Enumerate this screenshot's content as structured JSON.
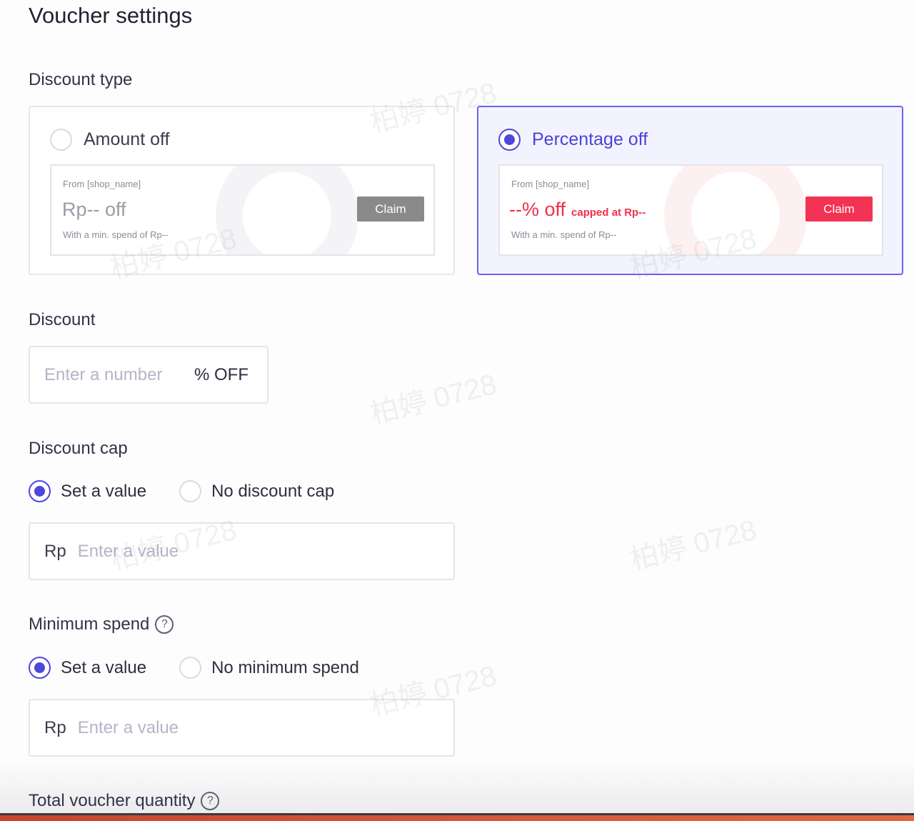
{
  "title": "Voucher settings",
  "discount_type": {
    "label": "Discount type",
    "options": [
      {
        "label": "Amount off",
        "selected": false,
        "preview": {
          "from": "From [shop_name]",
          "value": "Rp-- off",
          "min_spend": "With a min. spend of Rp--",
          "claim": "Claim",
          "claim_color": "#8a8a8a"
        }
      },
      {
        "label": "Percentage off",
        "selected": true,
        "preview": {
          "from": "From [shop_name]",
          "value": "--% off",
          "cap": "capped at Rp--",
          "min_spend": "With a min. spend of Rp--",
          "claim": "Claim",
          "claim_color": "#f23354"
        }
      }
    ]
  },
  "discount": {
    "label": "Discount",
    "placeholder": "Enter a number",
    "suffix": "% OFF"
  },
  "discount_cap": {
    "label": "Discount cap",
    "options": [
      {
        "label": "Set a value",
        "selected": true
      },
      {
        "label": "No discount cap",
        "selected": false
      }
    ],
    "prefix": "Rp",
    "placeholder": "Enter a value"
  },
  "minimum_spend": {
    "label": "Minimum spend",
    "help_icon": "question-circle-icon",
    "options": [
      {
        "label": "Set a value",
        "selected": true
      },
      {
        "label": "No minimum spend",
        "selected": false
      }
    ],
    "prefix": "Rp",
    "placeholder": "Enter a value"
  },
  "total_quantity": {
    "label": "Total voucher quantity",
    "help_icon": "question-circle-icon"
  },
  "watermark": "柏婷 0728",
  "colors": {
    "accent": "#4f47d9",
    "danger": "#f23354",
    "border": "#e4e5ec"
  }
}
